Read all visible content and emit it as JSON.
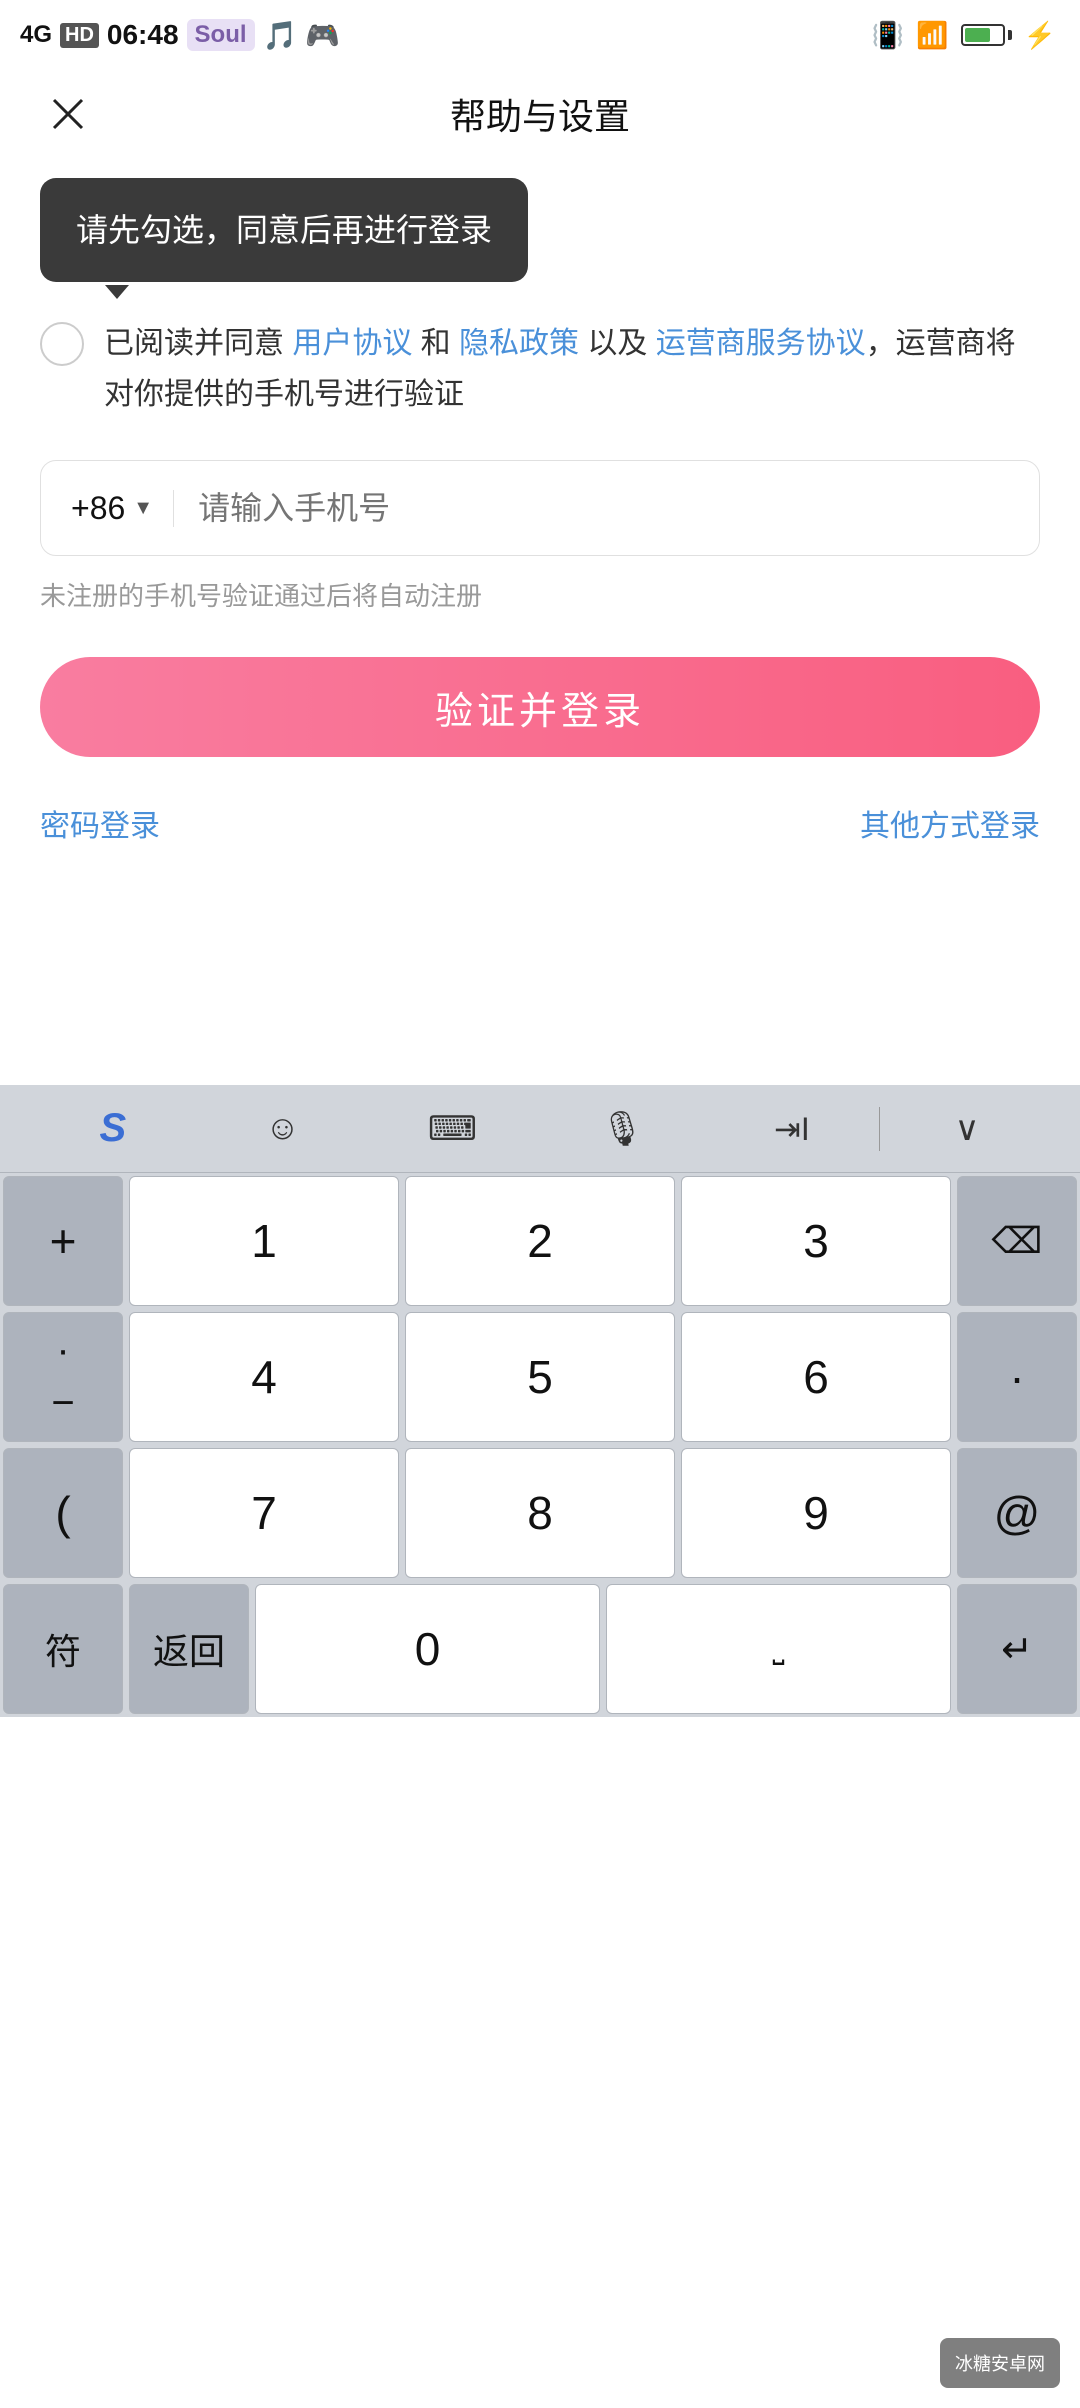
{
  "statusBar": {
    "time": "06:48",
    "network": "4G",
    "hd": "HD",
    "appName": "Soul",
    "batteryPercent": 73
  },
  "header": {
    "title": "帮助与设置",
    "closeLabel": "×"
  },
  "tooltip": {
    "message": "请先勾选，同意后再进行登录"
  },
  "agreement": {
    "prefixText": "已阅读并同意 ",
    "userAgreement": "用户协议",
    "and": " 和 ",
    "privacyPolicy": "隐私政策",
    "asWell": " 以及 ",
    "operatorAgreement": "运营商服务协议",
    "suffixText": "，运营商将对你提供的手机号进行验证"
  },
  "phoneInput": {
    "countryCode": "+86",
    "placeholder": "请输入手机号"
  },
  "note": {
    "text": "未注册的手机号验证通过后将自动注册"
  },
  "loginButton": {
    "label": "验证并登录"
  },
  "bottomLinks": {
    "passwordLogin": "密码登录",
    "otherLogin": "其他方式登录"
  },
  "keyboardToolbar": {
    "icons": [
      "S",
      "☺",
      "⌨",
      "🎤",
      "⇥",
      "∨"
    ]
  },
  "keyboard": {
    "rows": [
      [
        "+",
        "1",
        "2",
        "3",
        "⌫"
      ],
      [
        ".",
        "4",
        "5",
        "6",
        "·"
      ],
      [
        "(",
        "7",
        "8",
        "9",
        "@"
      ],
      [
        "符",
        "返回",
        "0",
        "␣",
        "↵"
      ]
    ]
  },
  "watermark": {
    "text": "冰糖安卓网"
  }
}
